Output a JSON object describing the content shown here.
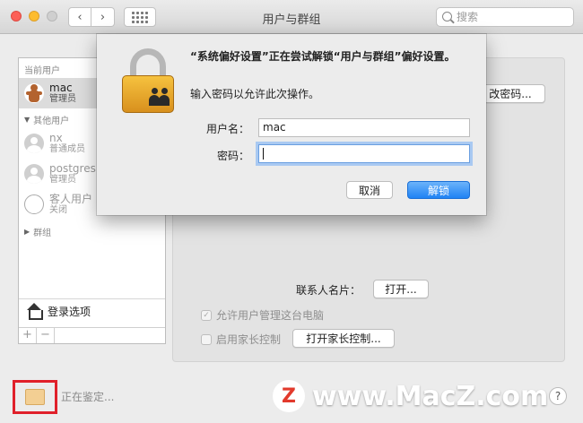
{
  "window": {
    "title": "用户与群组",
    "search_placeholder": "搜索"
  },
  "sidebar": {
    "current_users_header": "当前用户",
    "current_user": {
      "name": "mac",
      "role": "管理员"
    },
    "other_users_header": "其他用户",
    "other_users": [
      {
        "name": "nx",
        "role": "普通成员"
      },
      {
        "name": "postgres",
        "role": "管理员"
      },
      {
        "name": "客人用户",
        "role": "关闭"
      }
    ],
    "groups_header": "群组",
    "login_options": "登录选项",
    "add": "+",
    "remove": "−"
  },
  "main": {
    "change_password": "改密码...",
    "contact_card_label": "联系人名片：",
    "open_button": "打开...",
    "allow_admin": "允许用户管理这台电脑",
    "enable_parental": "启用家长控制",
    "open_parental": "打开家长控制..."
  },
  "footer": {
    "auth_text": "正在鉴定...",
    "help": "?"
  },
  "watermark": {
    "logo": "Z",
    "text": "www.MacZ.com"
  },
  "dialog": {
    "message": "“系统偏好设置”正在尝试解锁“用户与群组”偏好设置。",
    "sub": "输入密码以允许此次操作。",
    "username_label": "用户名：",
    "username_value": "mac",
    "password_label": "密码：",
    "password_value": "",
    "cancel": "取消",
    "unlock": "解锁"
  }
}
